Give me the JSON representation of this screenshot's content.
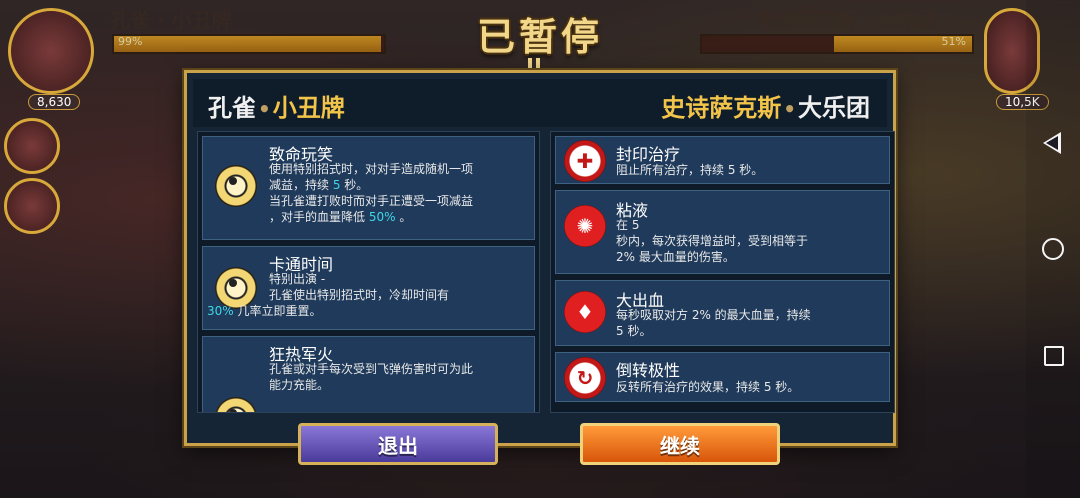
{
  "hud": {
    "left_name": "孔雀 · 小丑牌",
    "right_name": "史诗萨克斯 · 大乐团",
    "left_hp_pct": "99%",
    "right_hp_pct": "51%",
    "left_hp_fraction": 0.99,
    "right_hp_fraction": 0.51,
    "left_score": "8,630",
    "right_score": "10,5K"
  },
  "pause": {
    "title": "已暂停"
  },
  "panel": {
    "left_team": {
      "char": "孔雀",
      "sep": "•",
      "variant": "小丑牌"
    },
    "right_team": {
      "char": "史诗萨克斯",
      "sep": "•",
      "variant": "大乐团"
    },
    "left_abilities": [
      {
        "icon": "eyeball-icon",
        "title": "致命玩笑",
        "line1": "使用特别招式时，对对手造成随机一项",
        "line2_a": "减益，持续 ",
        "line2_hl": "5",
        "line2_b": " 秒。",
        "line3": "当孔雀遭打败时而对手正遭受一项减益",
        "line4_a": "，对手的血量降低 ",
        "line4_hl": "50%",
        "line4_b": " 。"
      },
      {
        "icon": "eyeball-icon",
        "title": "卡通时间",
        "line1": "特别出演 -",
        "line2": "孔雀使出特别招式时，冷却时间有",
        "line3_hl": "30%",
        "line3_b": " 几率立即重置。"
      },
      {
        "icon": "eyeball-icon",
        "title": "狂热军火",
        "line1": "孔雀或对手每次受到飞弹伤害时可为此",
        "line2": "能力充能。"
      }
    ],
    "right_abilities": [
      {
        "icon": "heal-block-icon",
        "title": "封印治疗",
        "line1": "阻止所有治疗，持续 5 秒。"
      },
      {
        "icon": "slime-splat-icon",
        "title": "粘液",
        "line1": "在 5",
        "line2": "秒内，每次获得增益时，受到相等于",
        "line3": "2% 最大血量的伤害。"
      },
      {
        "icon": "blood-drop-icon",
        "title": "大出血",
        "line1": "每秒吸取对方 2% 的最大血量，持续",
        "line2": "5 秒。"
      },
      {
        "icon": "reverse-heal-icon",
        "title": "倒转极性",
        "line1": "反转所有治疗的效果，持续 5 秒。"
      }
    ]
  },
  "buttons": {
    "exit": "退出",
    "continue": "继续"
  },
  "colors": {
    "accent_gold": "#f2c44a",
    "highlight": "#3fd6e8",
    "continue_orange": "#ff9a3a",
    "exit_purple": "#6a5ac0"
  },
  "nav": {
    "back": "back-icon",
    "home": "home-icon",
    "recents": "recents-icon"
  }
}
